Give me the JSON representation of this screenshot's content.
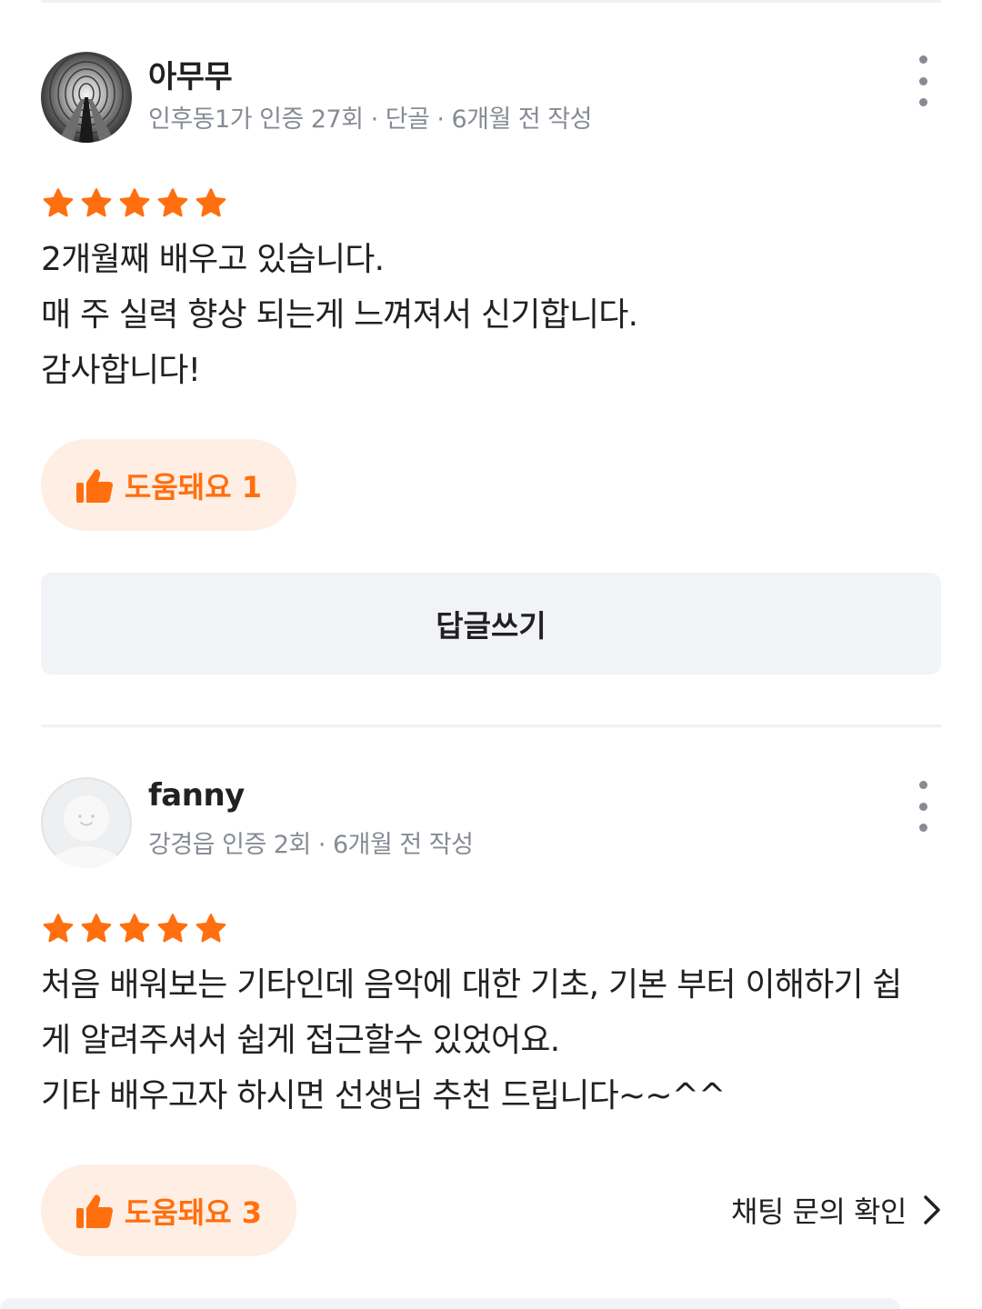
{
  "colors": {
    "accent": "#ff6f0f",
    "accent_bg": "#ffeee3",
    "star": "#ff6f0f",
    "meta_text": "#868b94",
    "reply_bg": "#f2f3f6"
  },
  "reviews": [
    {
      "author": "아무무",
      "avatar_icon": "tunnel-photo-avatar",
      "meta": {
        "location_cert": "인후동1가 인증 27회",
        "badge": "단골",
        "time": "6개월 전 작성"
      },
      "rating": 5,
      "body_lines": [
        "2개월째 배우고 있습니다.",
        "매 주 실력 향상 되는게 느껴져서 신기합니다.",
        "감사합니다!"
      ],
      "helpful_label": "도움돼요 1",
      "reply_label": "답글쓰기"
    },
    {
      "author": "fanny",
      "avatar_icon": "default-profile-avatar",
      "meta": {
        "location_cert": "강경읍 인증 2회",
        "time": "6개월 전 작성"
      },
      "rating": 5,
      "body_lines": [
        "처음 배워보는 기타인데 음악에 대한 기초, 기본 부터 이해하기 쉽",
        "게 알려주셔서 쉽게 접근할수 있었어요.",
        "기타 배우고자 하시면 선생님 추천 드립니다~~^^"
      ],
      "helpful_label": "도움돼요 3",
      "chat_link_label": "채팅 문의 확인"
    }
  ]
}
